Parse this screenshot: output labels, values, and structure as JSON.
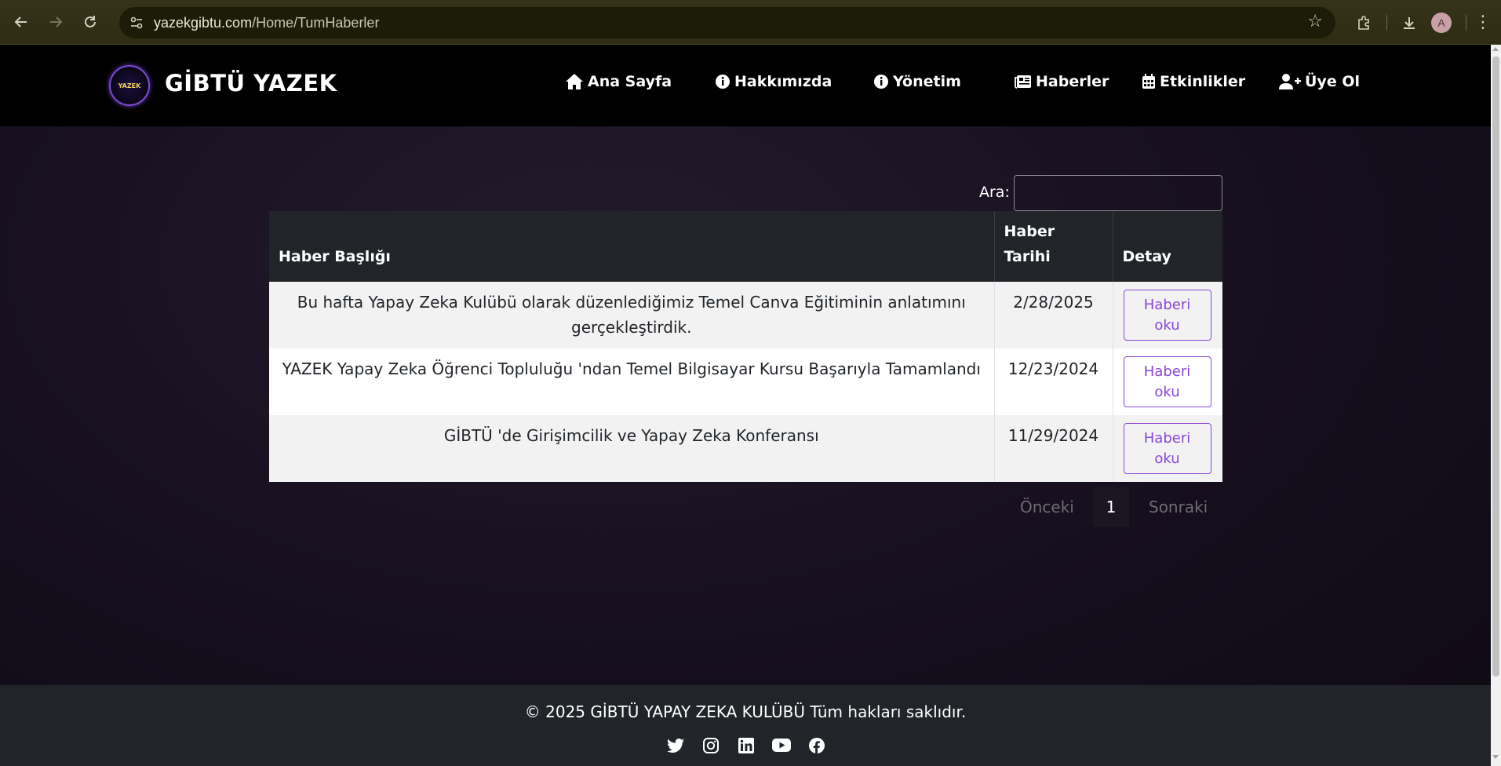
{
  "browser": {
    "url_host": "yazekgibtu.com",
    "url_path": "/Home/TumHaberler",
    "profile_initial": "A"
  },
  "site": {
    "logo_text": "YAZEK",
    "brand": "GİBTÜ YAZEK",
    "menu": [
      {
        "label": "Ana Sayfa",
        "icon": "home-icon"
      },
      {
        "label": "Hakkımızda",
        "icon": "info-circle-icon"
      },
      {
        "label": "Yönetim",
        "icon": "info-circle-icon"
      },
      {
        "label": "Haberler",
        "icon": "newspaper-icon"
      },
      {
        "label": "Etkinlikler",
        "icon": "calendar-icon"
      },
      {
        "label": "Üye Ol",
        "icon": "user-plus-icon"
      }
    ]
  },
  "search": {
    "label": "Ara:",
    "value": ""
  },
  "table": {
    "headers": {
      "title": "Haber Başlığı",
      "date_line1": "Haber",
      "date_line2": "Tarihi",
      "detail": "Detay"
    },
    "rows": [
      {
        "title": "Bu hafta Yapay Zeka Kulübü olarak düzenlediğimiz Temel Canva Eğitiminin anlatımını gerçekleştirdik.",
        "date": "2/28/2025",
        "button_line1": "Haberi",
        "button_line2": "oku"
      },
      {
        "title": "YAZEK Yapay Zeka Öğrenci Topluluğu 'ndan Temel Bilgisayar Kursu Başarıyla Tamamlandı",
        "date": "12/23/2024",
        "button_line1": "Haberi",
        "button_line2": "oku"
      },
      {
        "title": "GİBTÜ 'de Girişimcilik ve Yapay Zeka Konferansı",
        "date": "11/29/2024",
        "button_line1": "Haberi",
        "button_line2": "oku"
      }
    ]
  },
  "pagination": {
    "prev": "Önceki",
    "current": "1",
    "next": "Sonraki"
  },
  "footer": {
    "copyright": "© 2025 GİBTÜ YAPAY ZEKA KULÜBÜ Tüm hakları saklıdır.",
    "socials": [
      "twitter-icon",
      "instagram-icon",
      "linkedin-icon",
      "youtube-icon",
      "facebook-icon"
    ]
  },
  "colors": {
    "accent": "#8b46d6",
    "header_bg": "#000000",
    "table_header_bg": "#212529",
    "footer_bg": "#212529"
  }
}
